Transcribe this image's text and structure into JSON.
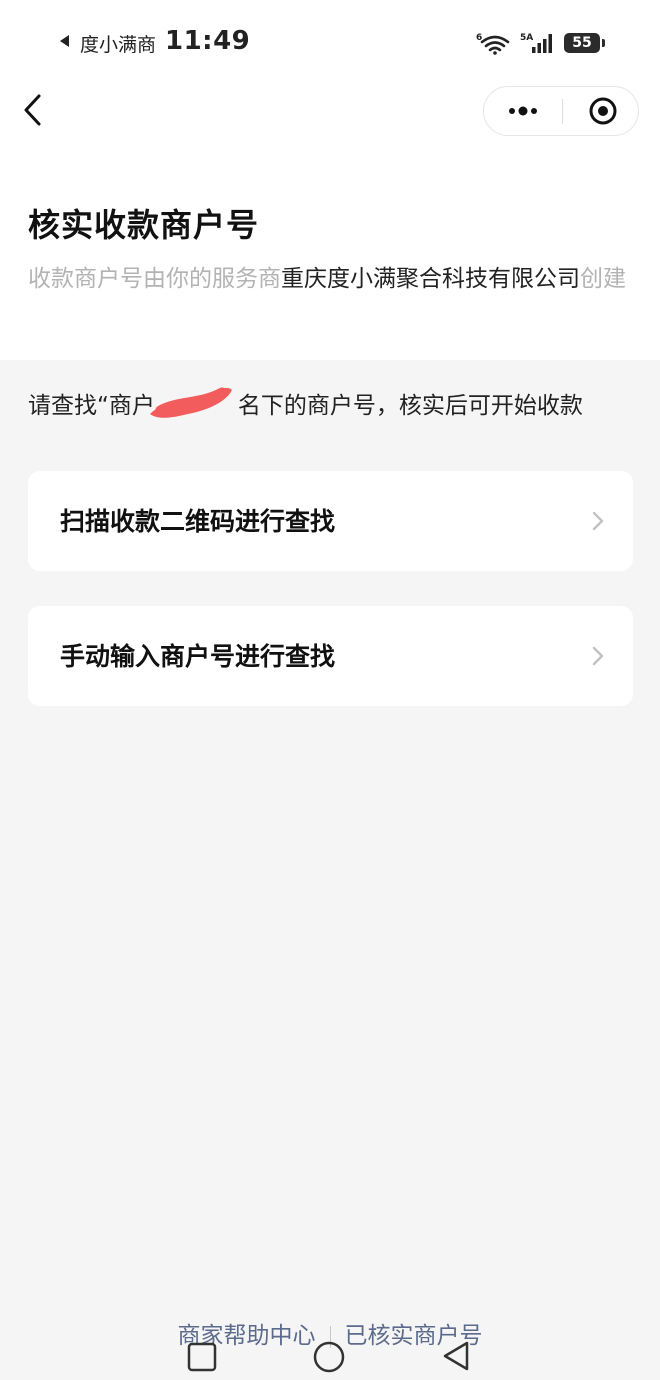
{
  "status_bar": {
    "app_name": "度小满商",
    "time": "11:49",
    "wifi_label": "6",
    "signal_label": "5A",
    "battery": "55"
  },
  "icons": {
    "back": "back-chevron-icon",
    "more": "more-dots-icon",
    "close": "target-circle-icon",
    "chevron": "chevron-right-icon",
    "redaction": "red-scribble-redaction"
  },
  "page": {
    "title": "核实收款商户号",
    "subtitle_gray": "收款商户号由你的服务商",
    "subtitle_company": "重庆度小满聚合科技有限公司",
    "subtitle_tail": "创建",
    "instruction_prefix": "请查找“商户",
    "instruction_suffix": "名下的商户号，核实后可开始收款"
  },
  "options": [
    {
      "label": "扫描收款二维码进行查找"
    },
    {
      "label": "手动输入商户号进行查找"
    }
  ],
  "footer": {
    "help_center": "商家帮助中心",
    "verified": "已核实商户号"
  },
  "colors": {
    "background": "#f5f5f5",
    "card": "#ffffff",
    "footer_link": "#5c6b8c",
    "subtitle_gray": "#b3b3b3",
    "redaction": "#f25c5c"
  }
}
